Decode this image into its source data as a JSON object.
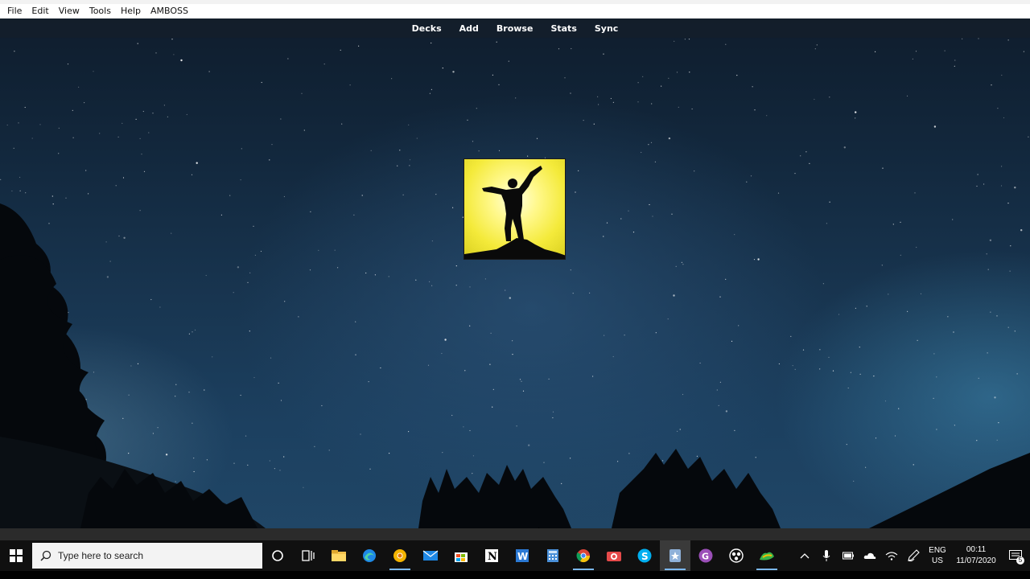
{
  "menubar": {
    "items": [
      {
        "label": "File"
      },
      {
        "label": "Edit"
      },
      {
        "label": "View"
      },
      {
        "label": "Tools"
      },
      {
        "label": "Help"
      },
      {
        "label": "AMBOSS"
      }
    ]
  },
  "toolbar": {
    "links": [
      {
        "label": "Decks"
      },
      {
        "label": "Add"
      },
      {
        "label": "Browse"
      },
      {
        "label": "Stats"
      },
      {
        "label": "Sync"
      }
    ]
  },
  "logo": {
    "icon": "person-silhouette-logo",
    "background": "#f4ea3a"
  },
  "taskbar": {
    "search_placeholder": "Type here to search",
    "apps": [
      "cortana-icon",
      "task-view-icon",
      "file-explorer-icon",
      "edge-icon",
      "chrome-canary-icon",
      "mail-icon",
      "store-icon",
      "notion-icon",
      "word-icon",
      "calculator-icon",
      "chrome-icon",
      "camera-app-icon",
      "skype-icon",
      "anki-icon",
      "onenote-icon",
      "obs-icon",
      "maps-icon"
    ]
  },
  "tray": {
    "language": "ENG",
    "region": "US",
    "time": "00:11",
    "date": "11/07/2020",
    "notification_count": "5"
  },
  "colors": {
    "accent": "#7cb8f0",
    "taskbar": "#101010",
    "sky": "#183550"
  }
}
